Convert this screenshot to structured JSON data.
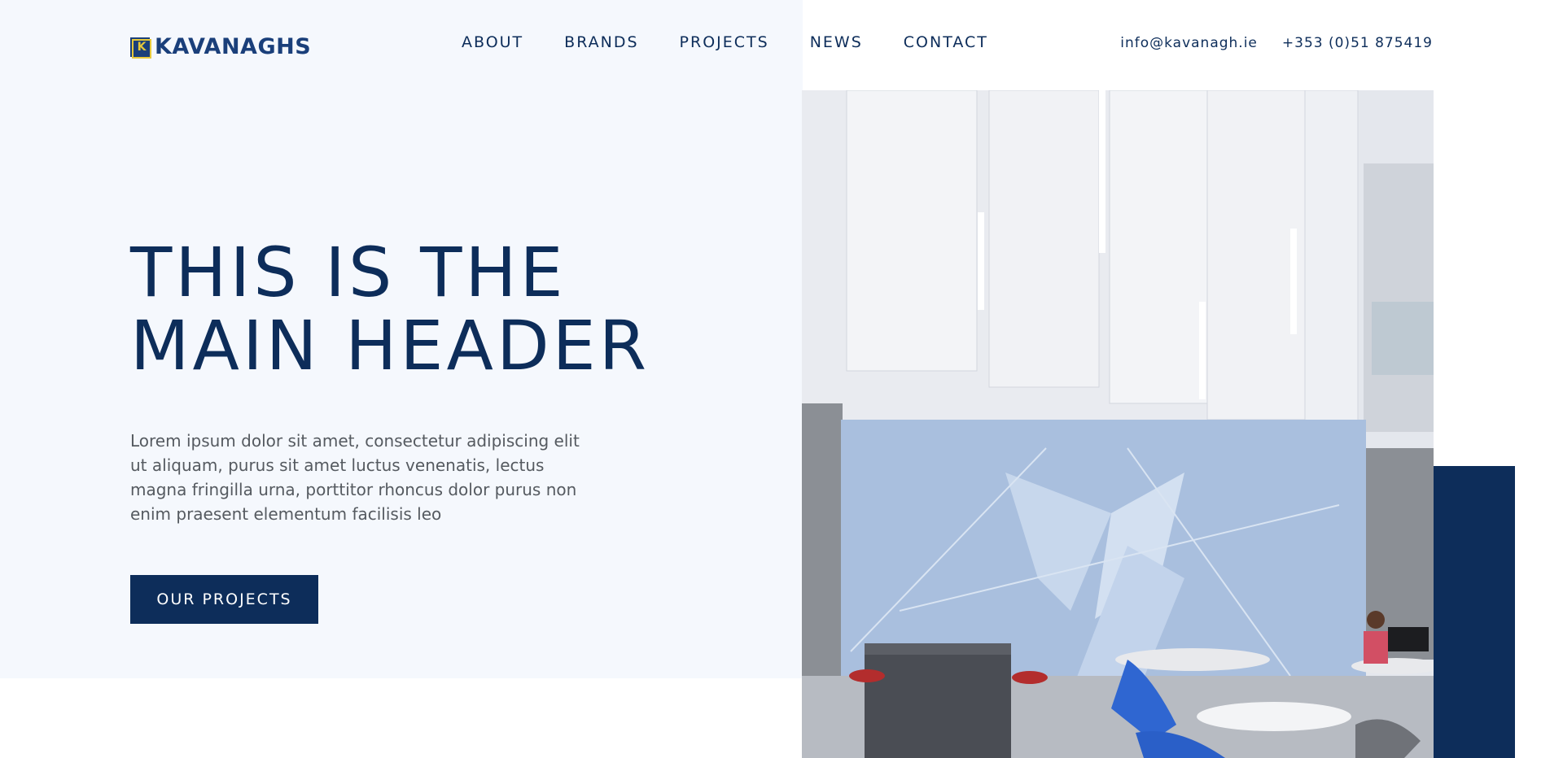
{
  "brand": {
    "name": "KAVANAGHS",
    "mark_letter": "K"
  },
  "nav": {
    "items": [
      {
        "label": "ABOUT"
      },
      {
        "label": "BRANDS"
      },
      {
        "label": "PROJECTS"
      },
      {
        "label": "NEWS"
      },
      {
        "label": "CONTACT"
      }
    ]
  },
  "contact": {
    "email": "info@kavanagh.ie",
    "phone": "+353 (0)51 875419"
  },
  "hero": {
    "title_line1": "THIS IS THE",
    "title_line2": "MAIN HEADER",
    "body": "Lorem ipsum dolor sit amet, consectetur adipiscing elit ut aliquam, purus sit amet luctus venenatis, lectus magna fringilla urna, porttitor rhoncus dolor purus non enim praesent elementum facilisis leo",
    "cta_label": "OUR PROJECTS"
  },
  "colors": {
    "navy": "#0d2d5a",
    "logo_blue": "#1a3f7a",
    "logo_gold": "#e7c93a",
    "panel_bg": "#f5f8fd",
    "body_text": "#555a60"
  },
  "icons": {
    "logo": "kavanaghs-k-logo-icon"
  }
}
